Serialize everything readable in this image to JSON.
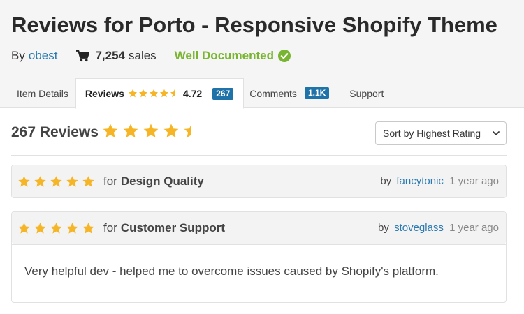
{
  "page": {
    "title": "Reviews for Porto - Responsive Shopify Theme",
    "by_label": "By",
    "author": "obest",
    "sales_count": "7,254",
    "sales_label": "sales",
    "documented_label": "Well Documented"
  },
  "tabs": {
    "item_details": "Item Details",
    "reviews": "Reviews",
    "reviews_rating": "4.72",
    "reviews_count": "267",
    "comments": "Comments",
    "comments_count": "1.1K",
    "support": "Support"
  },
  "summary": {
    "heading": "267 Reviews",
    "rating": 4.72,
    "sort_selected": "Sort by Highest Rating"
  },
  "reviews": [
    {
      "stars": 5,
      "for_label": "for",
      "category": "Design Quality",
      "by_label": "by",
      "reviewer": "fancytonic",
      "time": "1 year ago",
      "body": ""
    },
    {
      "stars": 5,
      "for_label": "for",
      "category": "Customer Support",
      "by_label": "by",
      "reviewer": "stoveglass",
      "time": "1 year ago",
      "body": "Very helpful dev - helped me to overcome issues caused by Shopify's platform."
    }
  ],
  "colors": {
    "star": "#f6b526",
    "link": "#2a7ab0",
    "documented": "#79b530",
    "badge": "#1f73a9"
  },
  "icons": {
    "cart": "cart-icon",
    "check": "check-circle-icon",
    "star": "star-icon",
    "chevron": "chevron-down-icon"
  }
}
